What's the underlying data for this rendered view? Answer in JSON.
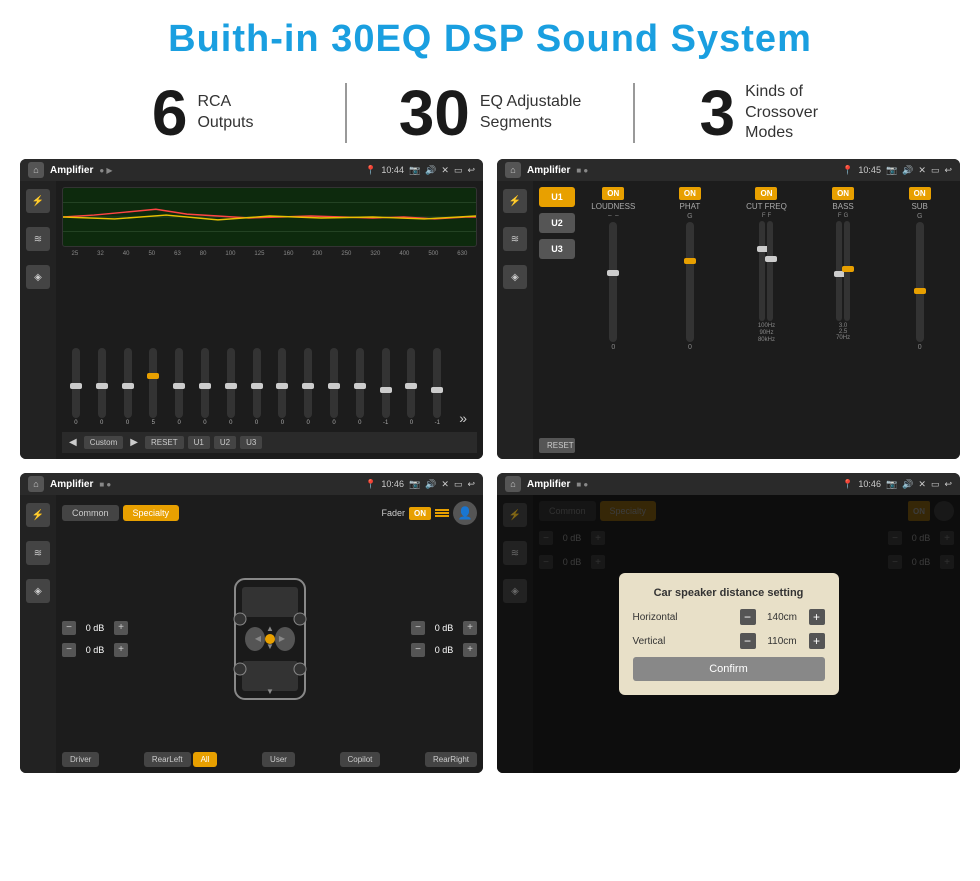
{
  "page": {
    "title": "Buith-in 30EQ DSP Sound System"
  },
  "stats": [
    {
      "number": "6",
      "label": "RCA\nOutputs"
    },
    {
      "number": "30",
      "label": "EQ Adjustable\nSegments"
    },
    {
      "number": "3",
      "label": "Kinds of\nCrossover Modes"
    }
  ],
  "screens": [
    {
      "id": "eq-screen",
      "title": "Amplifier",
      "time": "10:44",
      "type": "eq"
    },
    {
      "id": "crossover-screen",
      "title": "Amplifier",
      "time": "10:45",
      "type": "crossover"
    },
    {
      "id": "fader-screen",
      "title": "Amplifier",
      "time": "10:46",
      "type": "fader"
    },
    {
      "id": "dialog-screen",
      "title": "Amplifier",
      "time": "10:46",
      "type": "dialog"
    }
  ],
  "eq": {
    "freqs": [
      "25",
      "32",
      "40",
      "50",
      "63",
      "80",
      "100",
      "125",
      "160",
      "200",
      "250",
      "320",
      "400",
      "500",
      "630"
    ],
    "values": [
      "0",
      "0",
      "0",
      "5",
      "0",
      "0",
      "0",
      "0",
      "0",
      "0",
      "0",
      "0",
      "-1",
      "0",
      "-1"
    ],
    "presets": [
      "Custom",
      "RESET",
      "U1",
      "U2",
      "U3"
    ]
  },
  "crossover": {
    "presets": [
      "U1",
      "U2",
      "U3"
    ],
    "controls": [
      "LOUDNESS",
      "PHAT",
      "CUT FREQ",
      "BASS",
      "SUB"
    ],
    "reset_label": "RESET"
  },
  "fader": {
    "tabs": [
      "Common",
      "Specialty"
    ],
    "fader_label": "Fader",
    "on_label": "ON",
    "db_values": [
      "0 dB",
      "0 dB",
      "0 dB",
      "0 dB"
    ],
    "positions": [
      "Driver",
      "Copilot",
      "RearLeft",
      "All",
      "User",
      "RearRight"
    ]
  },
  "dialog": {
    "title": "Car speaker distance setting",
    "horizontal_label": "Horizontal",
    "horizontal_value": "140cm",
    "vertical_label": "Vertical",
    "vertical_value": "110cm",
    "confirm_label": "Confirm"
  }
}
